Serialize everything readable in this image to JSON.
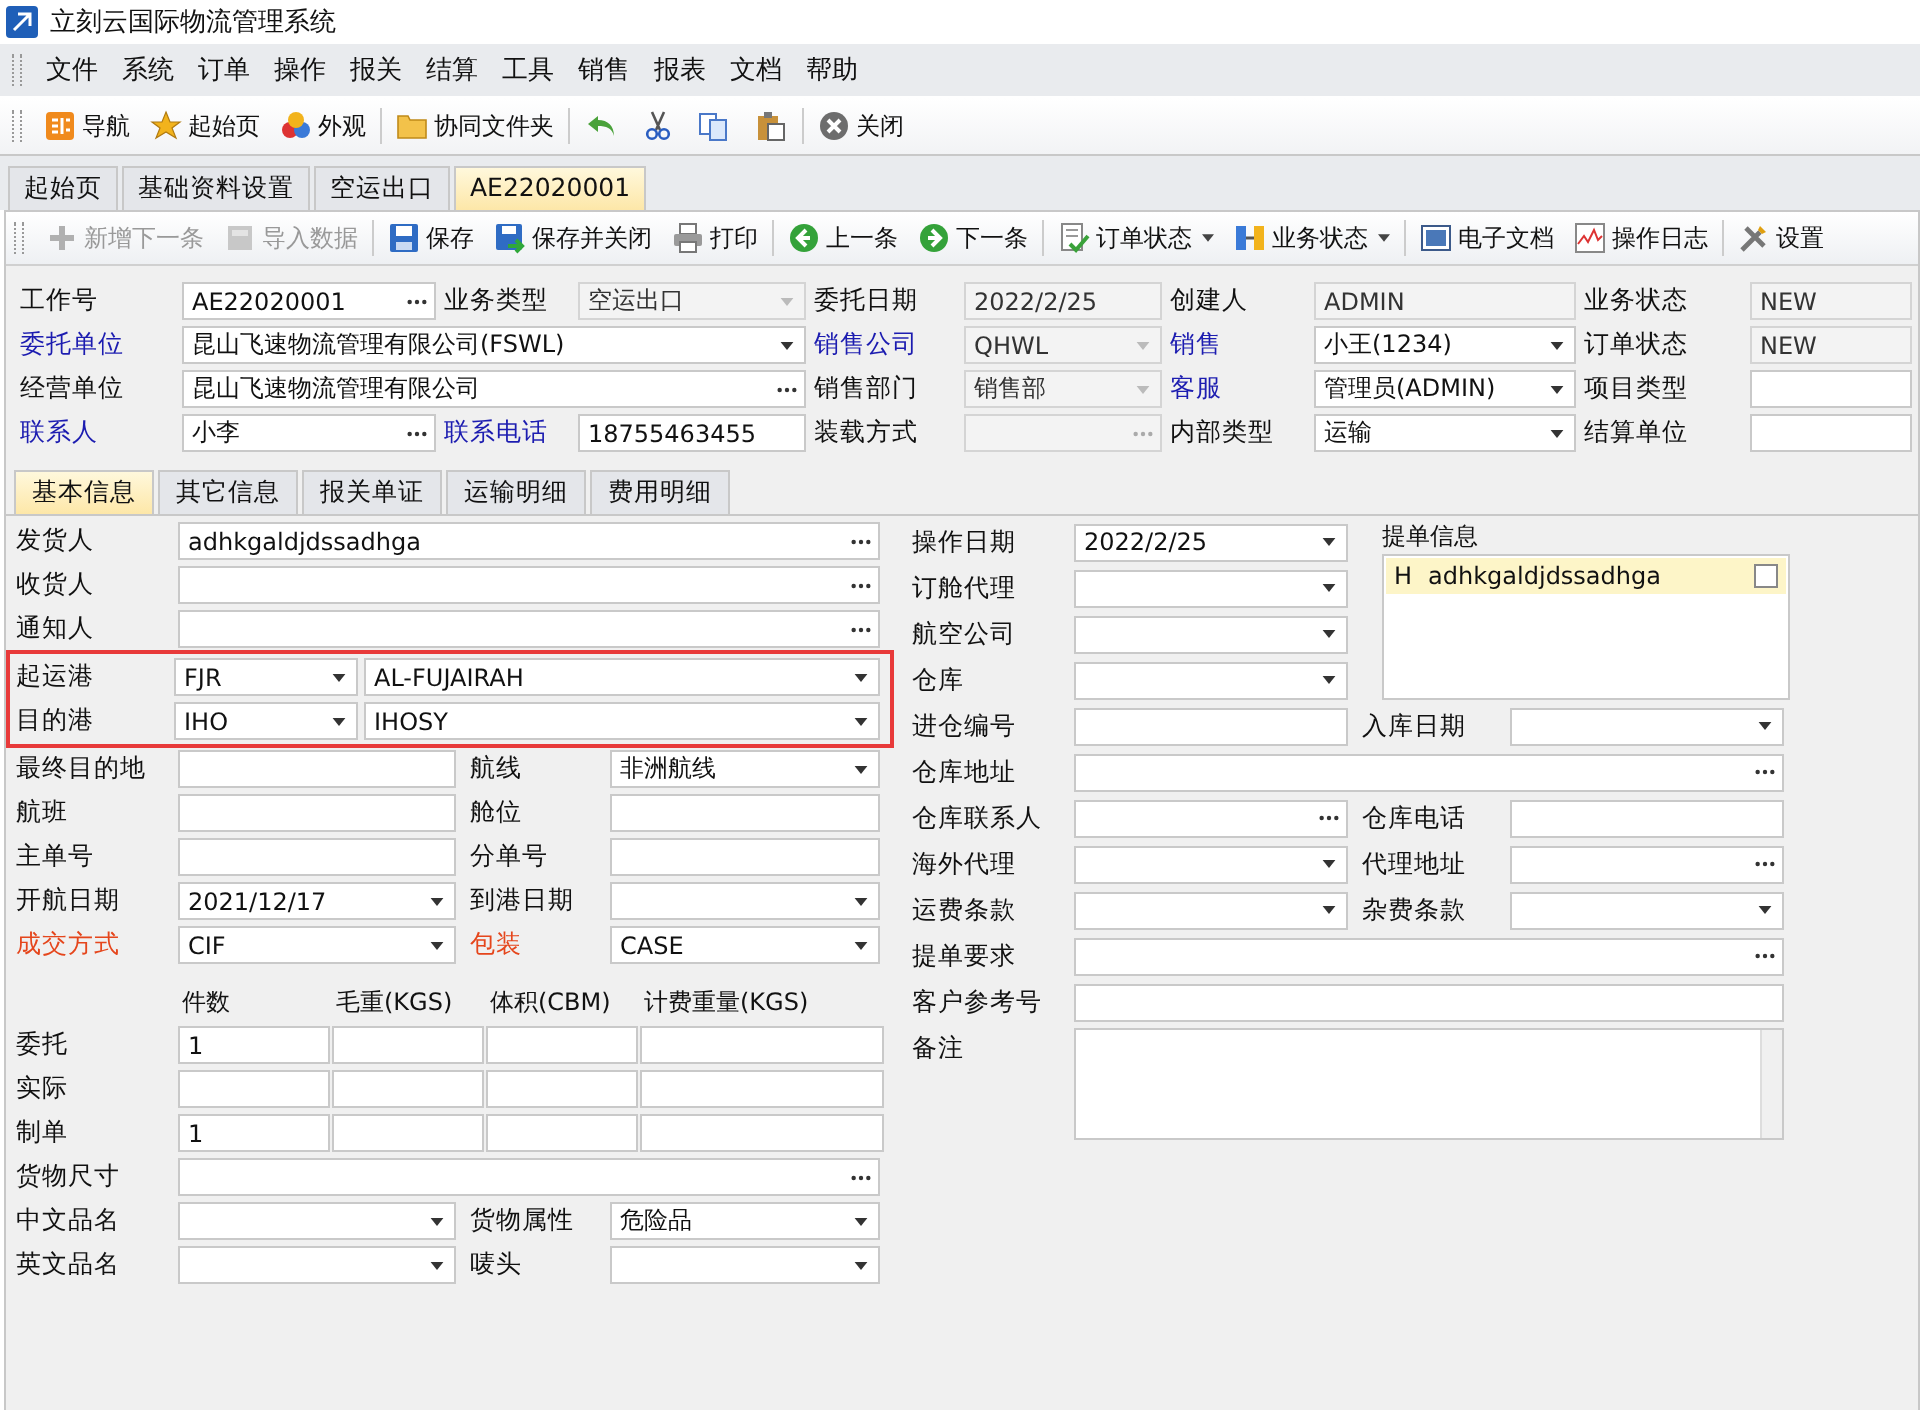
{
  "window": {
    "title": "立刻云国际物流管理系统"
  },
  "menu": [
    "文件",
    "系统",
    "订单",
    "操作",
    "报关",
    "结算",
    "工具",
    "销售",
    "报表",
    "文档",
    "帮助"
  ],
  "toolbar": [
    [
      {
        "kind": "button",
        "label": "导航"
      },
      {
        "kind": "button",
        "label": "起始页"
      },
      {
        "kind": "button",
        "label": "外观"
      }
    ],
    [
      {
        "kind": "button",
        "label": "协同文件夹"
      }
    ],
    [
      {
        "kind": "icon-button"
      },
      {
        "kind": "icon-button"
      },
      {
        "kind": "icon-button"
      },
      {
        "kind": "icon-button"
      }
    ],
    [
      {
        "kind": "button",
        "label": "关闭"
      }
    ]
  ],
  "doc_tabs": [
    {
      "label": "起始页",
      "selected": false
    },
    {
      "label": "基础资料设置",
      "selected": false
    },
    {
      "label": "空运出口",
      "selected": false
    },
    {
      "label": "AE22020001",
      "selected": true
    }
  ],
  "doc_toolbar": [
    [
      {
        "label": "新增下一条",
        "disabled": true,
        "dropdown": false
      },
      {
        "label": "导入数据",
        "disabled": true,
        "dropdown": false
      }
    ],
    [
      {
        "label": "保存",
        "disabled": false,
        "dropdown": false
      },
      {
        "label": "保存并关闭",
        "disabled": false,
        "dropdown": false
      },
      {
        "label": "打印",
        "disabled": false,
        "dropdown": false
      }
    ],
    [
      {
        "label": "上一条",
        "disabled": false,
        "dropdown": false
      },
      {
        "label": "下一条",
        "disabled": false,
        "dropdown": false
      }
    ],
    [
      {
        "label": "订单状态",
        "disabled": false,
        "dropdown": true
      },
      {
        "label": "业务状态",
        "disabled": false,
        "dropdown": true
      }
    ],
    [
      {
        "label": "电子文档",
        "disabled": false,
        "dropdown": false
      },
      {
        "label": "操作日志",
        "disabled": false,
        "dropdown": false
      }
    ],
    [
      {
        "label": "设置",
        "disabled": false,
        "dropdown": false
      }
    ]
  ],
  "header": [
    [
      {
        "label": "工作号",
        "color": "#111111",
        "kind": "lookup",
        "disabled": false,
        "value": "AE22020001"
      },
      {
        "label": "业务类型",
        "color": "#111111",
        "kind": "combo",
        "disabled": true,
        "value": "空运出口"
      },
      {
        "label": "委托日期",
        "color": "#111111",
        "kind": "text",
        "disabled": true,
        "value": "2022/2/25"
      },
      {
        "label": "创建人",
        "color": "#111111",
        "kind": "text",
        "disabled": true,
        "value": "ADMIN"
      },
      {
        "label": "业务状态",
        "color": "#111111",
        "kind": "text",
        "disabled": true,
        "value": "NEW"
      }
    ],
    [
      {
        "label": "委托单位",
        "color": "#1c1cb0",
        "kind": "combo",
        "disabled": false,
        "value": "昆山飞速物流管理有限公司(FSWL)"
      },
      {
        "label": "销售公司",
        "color": "#1c1cb0",
        "kind": "combo",
        "disabled": true,
        "value": "QHWL"
      },
      {
        "label": "销售",
        "color": "#1c1cb0",
        "kind": "combo",
        "disabled": false,
        "value": "小王(1234)"
      },
      {
        "label": "订单状态",
        "color": "#111111",
        "kind": "text",
        "disabled": true,
        "value": "NEW"
      }
    ],
    [
      {
        "label": "经营单位",
        "color": "#111111",
        "kind": "lookup",
        "disabled": false,
        "value": "昆山飞速物流管理有限公司"
      },
      {
        "label": "销售部门",
        "color": "#111111",
        "kind": "combo",
        "disabled": true,
        "value": "销售部"
      },
      {
        "label": "客服",
        "color": "#1c1cb0",
        "kind": "combo",
        "disabled": false,
        "value": "管理员(ADMIN)"
      },
      {
        "label": "项目类型",
        "color": "#111111",
        "kind": "text",
        "disabled": false
      }
    ],
    [
      {
        "label": "联系人",
        "color": "#1c1cb0",
        "kind": "lookup",
        "disabled": false,
        "value": "小李"
      },
      {
        "label": "联系电话",
        "color": "#1c1cb0",
        "kind": "text",
        "disabled": false,
        "value": "18755463455"
      },
      {
        "label": "装载方式",
        "color": "#111111",
        "kind": "lookup",
        "disabled": true
      },
      {
        "label": "内部类型",
        "color": "#111111",
        "kind": "combo",
        "disabled": false,
        "value": "运输"
      },
      {
        "label": "结算单位",
        "color": "#111111",
        "kind": "text",
        "disabled": false
      }
    ]
  ],
  "detail_tabs": [
    {
      "label": "基本信息",
      "selected": true
    },
    {
      "label": "其它信息",
      "selected": false
    },
    {
      "label": "报关单证",
      "selected": false
    },
    {
      "label": "运输明细",
      "selected": false
    },
    {
      "label": "费用明细",
      "selected": false
    }
  ],
  "parties": [
    {
      "label": "发货人",
      "color": "#111111",
      "kind": "lookup",
      "value": "adhkgaldjdssadhga"
    },
    {
      "label": "收货人",
      "color": "#111111",
      "kind": "lookup"
    },
    {
      "label": "通知人",
      "color": "#111111",
      "kind": "lookup"
    }
  ],
  "ports": {
    "highlighted": true,
    "rows": [
      {
        "label": "起运港",
        "code": "FJR",
        "name": "AL-FUJAIRAH"
      },
      {
        "label": "目的港",
        "code": "IHO",
        "name": "IHOSY"
      }
    ]
  },
  "shipping": [
    [
      {
        "label": "最终目的地",
        "color": "#111111",
        "kind": "text"
      },
      {
        "label": "航线",
        "color": "#111111",
        "kind": "combo",
        "value": "非洲航线"
      }
    ],
    [
      {
        "label": "航班",
        "color": "#111111",
        "kind": "text"
      },
      {
        "label": "舱位",
        "color": "#111111",
        "kind": "text"
      }
    ],
    [
      {
        "label": "主单号",
        "color": "#111111",
        "kind": "text"
      },
      {
        "label": "分单号",
        "color": "#111111",
        "kind": "text"
      }
    ],
    [
      {
        "label": "开航日期",
        "color": "#111111",
        "kind": "date",
        "value": "2021/12/17"
      },
      {
        "label": "到港日期",
        "color": "#111111",
        "kind": "date"
      }
    ],
    [
      {
        "label": "成交方式",
        "color": "#e5461c",
        "kind": "combo",
        "value": "CIF"
      },
      {
        "label": "包装",
        "color": "#e5461c",
        "kind": "combo",
        "value": "CASE"
      }
    ]
  ],
  "measures": {
    "columns": [
      "件数",
      "毛重(KGS)",
      "体积(CBM)",
      "计费重量(KGS)"
    ],
    "rows": [
      {
        "label": "委托",
        "values": [
          "1"
        ]
      },
      {
        "label": "实际",
        "values": []
      },
      {
        "label": "制单",
        "values": [
          "1"
        ]
      }
    ]
  },
  "cargo_size": {
    "label": "货物尺寸",
    "color": "#111111",
    "kind": "lookup"
  },
  "goods": [
    [
      {
        "label": "中文品名",
        "color": "#111111",
        "kind": "combo"
      },
      {
        "label": "货物属性",
        "color": "#111111",
        "kind": "combo",
        "value": "危险品"
      }
    ],
    [
      {
        "label": "英文品名",
        "color": "#111111",
        "kind": "combo"
      },
      {
        "label": "唛头",
        "color": "#111111",
        "kind": "combo"
      }
    ]
  ],
  "operations": [
    [
      {
        "label": "操作日期",
        "color": "#111111",
        "kind": "date",
        "value": "2022/2/25"
      }
    ],
    [
      {
        "label": "订舱代理",
        "color": "#111111",
        "kind": "combo"
      }
    ],
    [
      {
        "label": "航空公司",
        "color": "#111111",
        "kind": "combo"
      }
    ],
    [
      {
        "label": "仓库",
        "color": "#111111",
        "kind": "combo"
      }
    ],
    [
      {
        "label": "进仓编号",
        "color": "#111111",
        "kind": "text"
      },
      {
        "label": "入库日期",
        "color": "#111111",
        "kind": "date"
      }
    ],
    [
      {
        "label": "仓库地址",
        "color": "#111111",
        "kind": "lookup"
      }
    ],
    [
      {
        "label": "仓库联系人",
        "color": "#111111",
        "kind": "lookup"
      },
      {
        "label": "仓库电话",
        "color": "#111111",
        "kind": "text"
      }
    ],
    [
      {
        "label": "海外代理",
        "color": "#111111",
        "kind": "combo"
      },
      {
        "label": "代理地址",
        "color": "#111111",
        "kind": "lookup"
      }
    ],
    [
      {
        "label": "运费条款",
        "color": "#111111",
        "kind": "combo"
      },
      {
        "label": "杂费条款",
        "color": "#111111",
        "kind": "combo"
      }
    ],
    [
      {
        "label": "提单要求",
        "color": "#111111",
        "kind": "lookup"
      }
    ],
    [
      {
        "label": "客户参考号",
        "color": "#111111",
        "kind": "text"
      }
    ],
    [
      {
        "label": "备注",
        "color": "#111111",
        "kind": "textarea"
      }
    ]
  ],
  "bill_info": {
    "title": "提单信息",
    "rows": [
      {
        "marker": "H",
        "text": "adhkgaldjdssadhga",
        "selected": true,
        "checked": false
      }
    ]
  }
}
